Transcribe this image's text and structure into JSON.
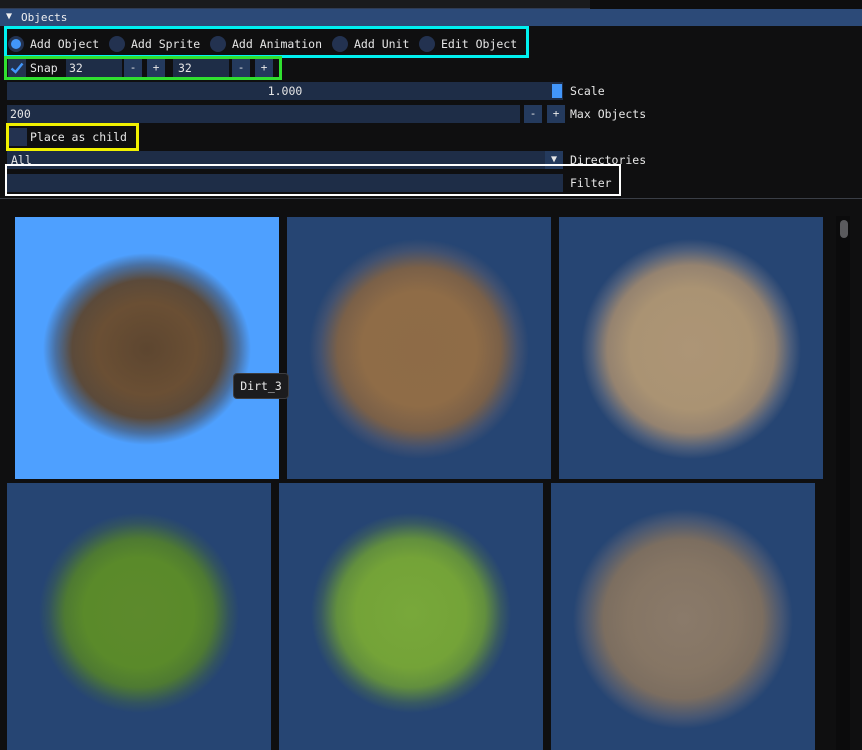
{
  "window": {
    "title": "Objects"
  },
  "modes": {
    "options": [
      "Add Object",
      "Add Sprite",
      "Add Animation",
      "Add Unit",
      "Edit Object"
    ],
    "selected": "Add Object"
  },
  "snap": {
    "label": "Snap",
    "checked": true,
    "x_value": "32",
    "y_value": "32",
    "minus": "-",
    "plus": "+"
  },
  "scale": {
    "value": "1.000",
    "label": "Scale"
  },
  "max_objects": {
    "value": "200",
    "label": "Max Objects",
    "minus": "-",
    "plus": "+"
  },
  "place_as_child": {
    "label": "Place as child",
    "checked": false
  },
  "directories": {
    "selected": "All",
    "label": "Directories"
  },
  "filter": {
    "value": "",
    "label": "Filter"
  },
  "tooltip": {
    "text": "Dirt_3"
  },
  "assets": [
    {
      "kind": "dirt-dark",
      "selected": true
    },
    {
      "kind": "dirt-medium",
      "selected": false
    },
    {
      "kind": "dirt-light",
      "selected": false
    },
    {
      "kind": "grass-dark",
      "selected": false
    },
    {
      "kind": "grass-light",
      "selected": false
    },
    {
      "kind": "dirt-gravel",
      "selected": false
    }
  ],
  "colors": {
    "accent": "#4296fa",
    "header": "#2c4a78",
    "tile_background": "#264573",
    "tile_selected": "#4ea0ff",
    "highlight_cyan": "#00f0f0",
    "highlight_green": "#30e030",
    "highlight_yellow": "#f0f000",
    "highlight_white": "#ffffff"
  }
}
